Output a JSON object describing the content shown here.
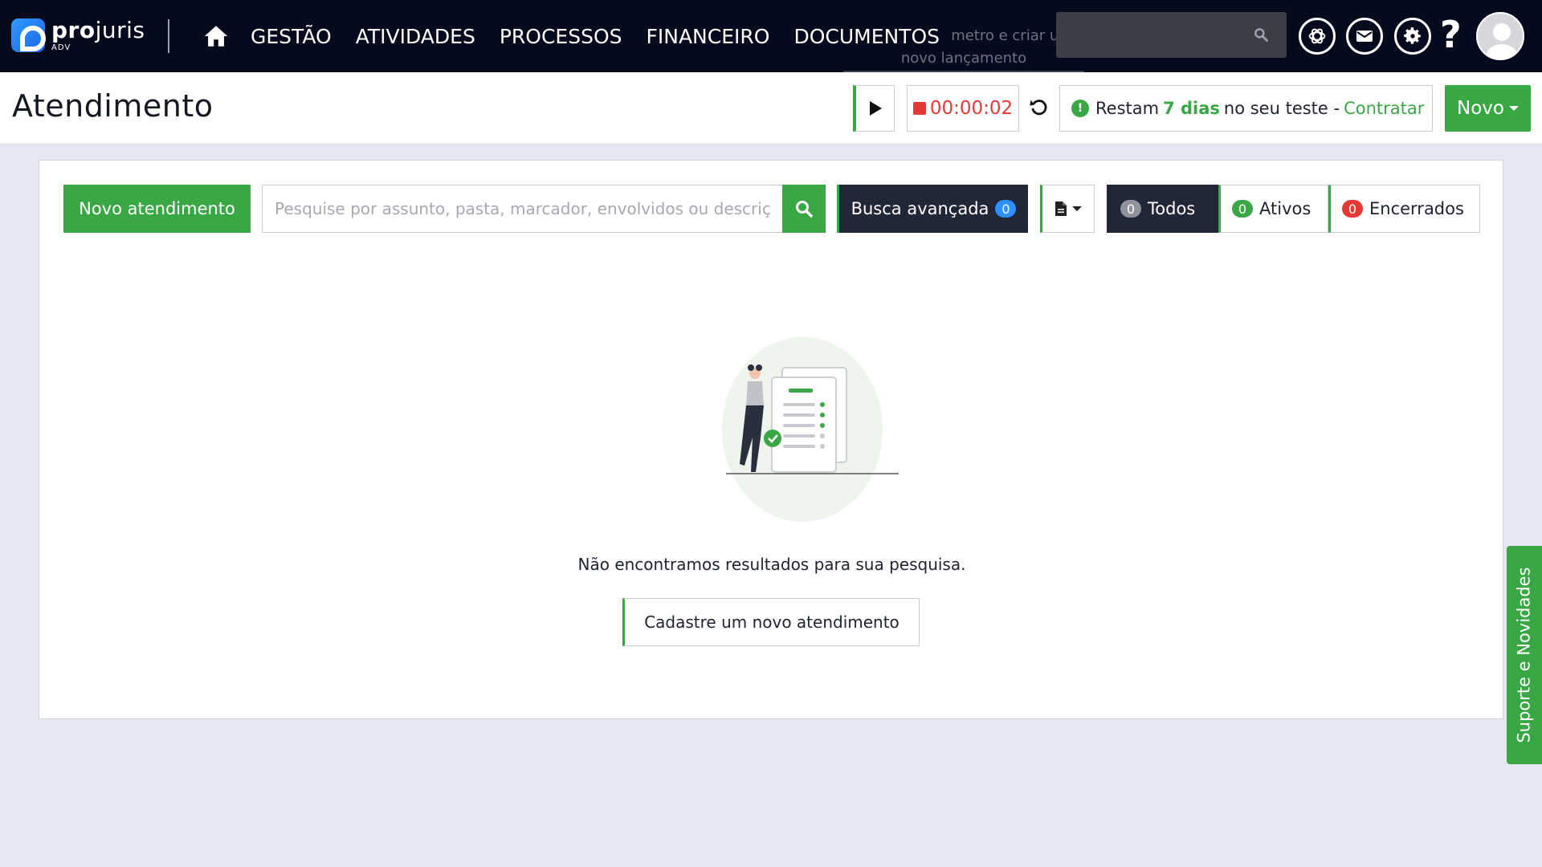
{
  "brand": {
    "name_bold": "pro",
    "name_light": "juris",
    "sub": "ADV"
  },
  "nav": {
    "items": [
      "GESTÃO",
      "ATIVIDADES",
      "PROCESSOS",
      "FINANCEIRO",
      "DOCUMENTOS"
    ],
    "tooltip_line1": "metro e criar um",
    "tooltip_line2": "novo lançamento",
    "icons": [
      "home-icon",
      "search-icon",
      "chatgpt-icon",
      "mail-icon",
      "gear-icon",
      "help-icon",
      "avatar"
    ]
  },
  "header": {
    "title": "Atendimento",
    "timer": "00:00:02",
    "trial_prefix": "Restam",
    "trial_days": "7 dias",
    "trial_suffix": "no seu teste -",
    "trial_link": "Contratar",
    "new_button": "Novo"
  },
  "toolbar": {
    "new_button": "Novo atendimento",
    "search_placeholder": "Pesquise por assunto, pasta, marcador, envolvidos ou descrição",
    "advanced_search": "Busca avançada",
    "advanced_count": "0",
    "filters": [
      {
        "label": "Todos",
        "count": "0"
      },
      {
        "label": "Ativos",
        "count": "0"
      },
      {
        "label": "Encerrados",
        "count": "0"
      }
    ]
  },
  "empty_state": {
    "message": "Não encontramos resultados para sua pesquisa.",
    "button": "Cadastre um novo atendimento"
  },
  "side_tab": "Suporte e Novidades",
  "colors": {
    "accent": "#3aa745",
    "nav_bg": "#050a1d",
    "danger": "#e53935",
    "badge_blue": "#2f8fff",
    "dark_button": "#222737"
  }
}
